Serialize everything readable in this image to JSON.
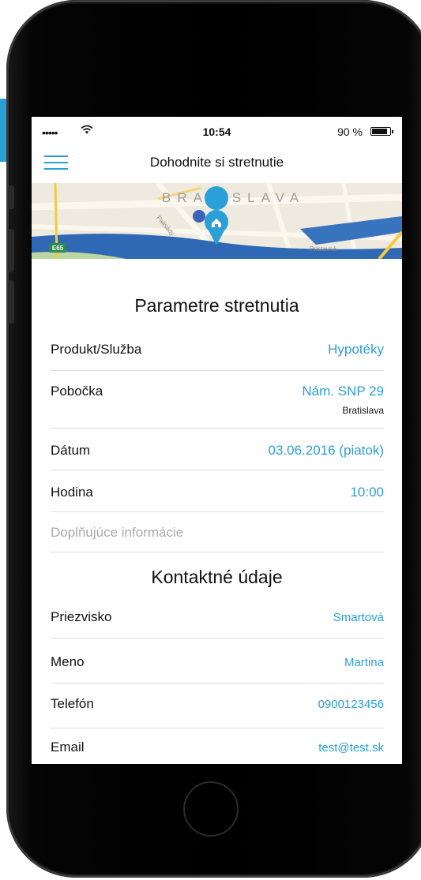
{
  "status": {
    "signal": "•••••",
    "time": "10:54",
    "battery": "90 %",
    "battery_level": 0.9
  },
  "nav": {
    "title": "Dohodnite si stretnutie"
  },
  "map": {
    "city_label": "BRATISLAVA",
    "road_badge": "E65",
    "street_labels": [
      "Palisády",
      "Prístavná"
    ]
  },
  "params": {
    "title": "Parametre stretnutia",
    "product_label": "Produkt/Služba",
    "product_value": "Hypotéky",
    "branch_label": "Pobočka",
    "branch_value": "Nám. SNP 29",
    "branch_city": "Bratislava",
    "date_label": "Dátum",
    "date_value": "03.06.2016 (piatok)",
    "hour_label": "Hodina",
    "hour_value": "10:00",
    "extra_placeholder": "Doplňujúce informácie"
  },
  "contact": {
    "title": "Kontaktné údaje",
    "surname_label": "Priezvisko",
    "surname_value": "Smartová",
    "name_label": "Meno",
    "name_value": "Martina",
    "phone_label": "Telefón",
    "phone_value": "0900123456",
    "email_label": "Email",
    "email_value": "test@test.sk"
  },
  "colors": {
    "accent": "#2a9fd8",
    "text": "#111111",
    "placeholder": "#aaaaaa",
    "divider": "#dddddd"
  },
  "icons": {
    "menu": "hamburger-menu-icon",
    "map_pin": "location-pin-icon",
    "wifi": "wifi-icon",
    "battery": "battery-icon"
  }
}
